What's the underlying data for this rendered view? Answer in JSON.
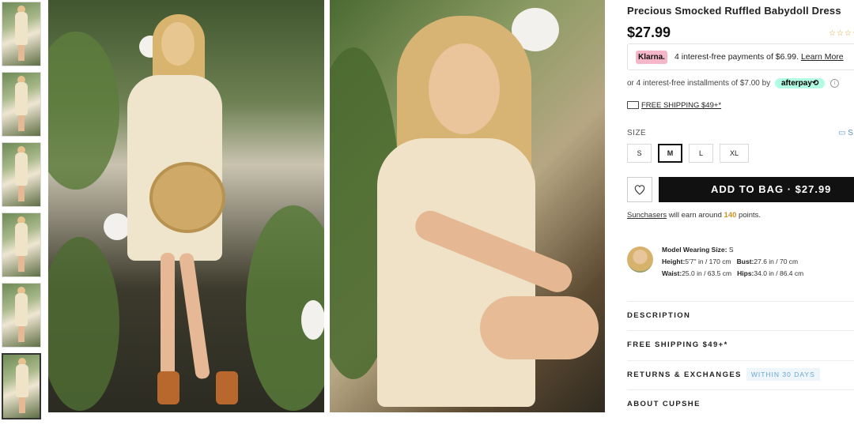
{
  "product": {
    "title": "Precious Smocked Ruffled Babydoll Dress",
    "price": "$27.99",
    "rating_stars": "☆☆☆☆"
  },
  "klarna": {
    "logo": "Klarna.",
    "text": "4 interest-free payments of $6.99.",
    "link": "Learn More"
  },
  "afterpay": {
    "text": "or 4 interest-free installments of $7.00 by",
    "badge": "afterpay⟲"
  },
  "shipping_link": "FREE SHIPPING $49+*",
  "size": {
    "label": "SIZE",
    "guide": "S",
    "options": [
      "S",
      "M",
      "L",
      "XL"
    ],
    "selected": "M"
  },
  "add_to_bag": "ADD TO BAG · $27.99",
  "points": {
    "link": "Sunchasers",
    "pre": " will earn around ",
    "amount": "140",
    "post": " points."
  },
  "model": {
    "wearing_label": "Model Wearing Size:",
    "wearing_value": " S",
    "height_label": "Height:",
    "height_value": "5'7'' in / 170 cm",
    "bust_label": "Bust:",
    "bust_value": "27.6 in / 70 cm",
    "waist_label": "Waist:",
    "waist_value": "25.0 in / 63.5 cm",
    "hips_label": "Hips:",
    "hips_value": "34.0 in / 86.4 cm"
  },
  "accordion": {
    "description": "DESCRIPTION",
    "free_shipping": "FREE SHIPPING $49+*",
    "returns": "RETURNS & EXCHANGES",
    "returns_tag": "WITHIN 30 DAYS",
    "about": "ABOUT CUPSHE"
  },
  "colors": {
    "button_bg": "#111111",
    "klarna_pink": "#f6b6c9",
    "afterpay_mint": "#b2fce4",
    "points_gold": "#c9952c"
  }
}
